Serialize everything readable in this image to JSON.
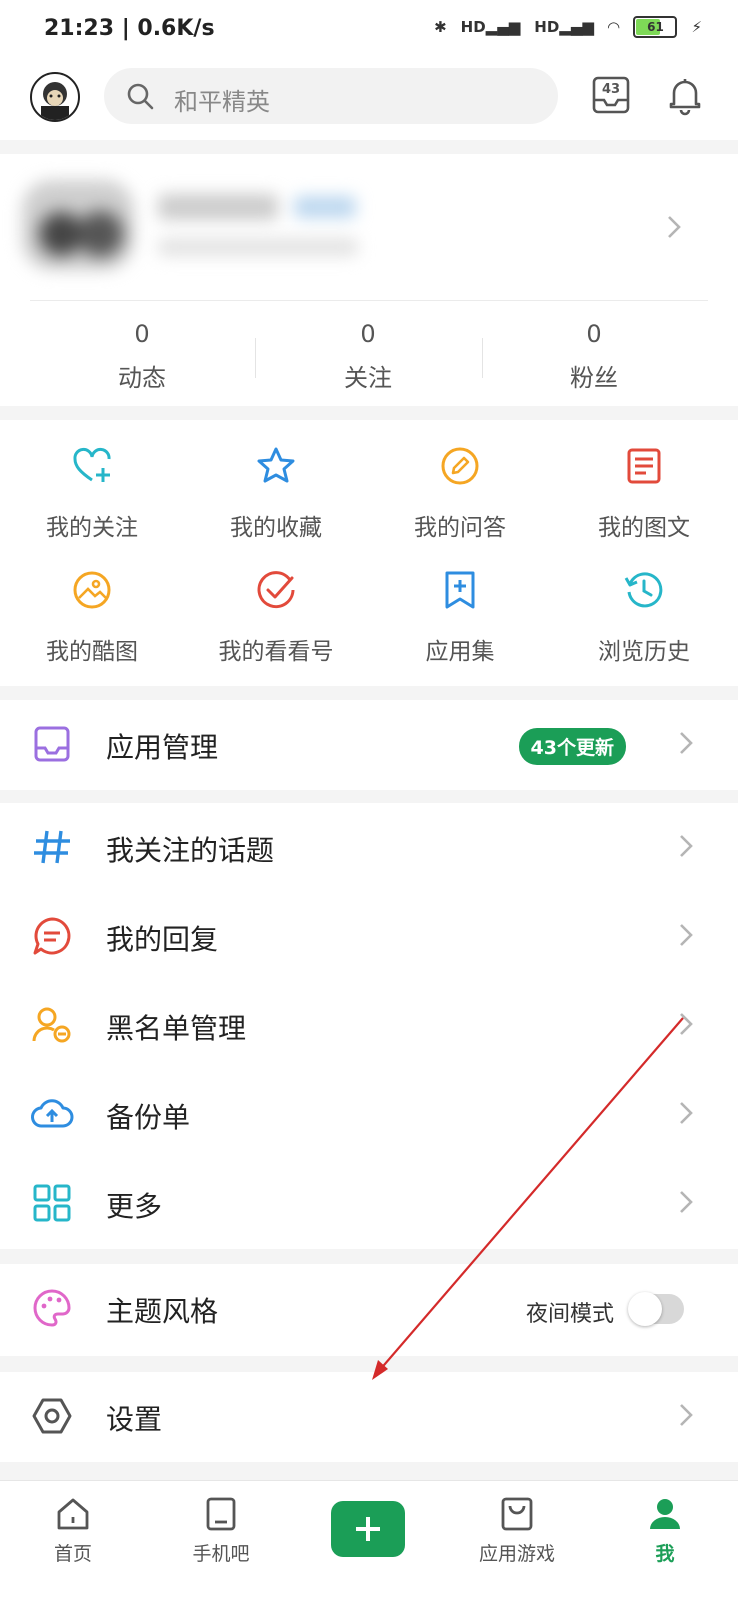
{
  "status_bar": {
    "time": "21:23 | 0.6K/s",
    "battery": "61"
  },
  "header": {
    "search_placeholder": "和平精英",
    "inbox_count": "43"
  },
  "profile": {
    "stats": [
      {
        "value": "0",
        "label": "动态"
      },
      {
        "value": "0",
        "label": "关注"
      },
      {
        "value": "0",
        "label": "粉丝"
      }
    ]
  },
  "quick_actions": [
    {
      "label": "我的关注",
      "icon": "heart-plus-icon"
    },
    {
      "label": "我的收藏",
      "icon": "star-icon"
    },
    {
      "label": "我的问答",
      "icon": "pencil-icon"
    },
    {
      "label": "我的图文",
      "icon": "document-icon"
    },
    {
      "label": "我的酷图",
      "icon": "image-icon"
    },
    {
      "label": "我的看看号",
      "icon": "check-circle-icon"
    },
    {
      "label": "应用集",
      "icon": "bookmark-plus-icon"
    },
    {
      "label": "浏览历史",
      "icon": "history-icon"
    }
  ],
  "menu": {
    "app_manage": {
      "label": "应用管理",
      "badge": "43个更新"
    },
    "topics": {
      "label": "我关注的话题"
    },
    "replies": {
      "label": "我的回复"
    },
    "blacklist": {
      "label": "黑名单管理"
    },
    "backup": {
      "label": "备份单"
    },
    "more": {
      "label": "更多"
    },
    "theme": {
      "label": "主题风格",
      "night_mode_label": "夜间模式",
      "night_mode_on": false
    },
    "settings": {
      "label": "设置"
    }
  },
  "bottom_nav": [
    {
      "label": "首页",
      "icon": "home-icon"
    },
    {
      "label": "手机吧",
      "icon": "phone-icon"
    },
    {
      "label": "应用游戏",
      "icon": "bag-icon"
    },
    {
      "label": "我",
      "icon": "user-icon"
    }
  ],
  "colors": {
    "brand_green": "#1b9e57",
    "annotation_red": "#d42a2a"
  }
}
